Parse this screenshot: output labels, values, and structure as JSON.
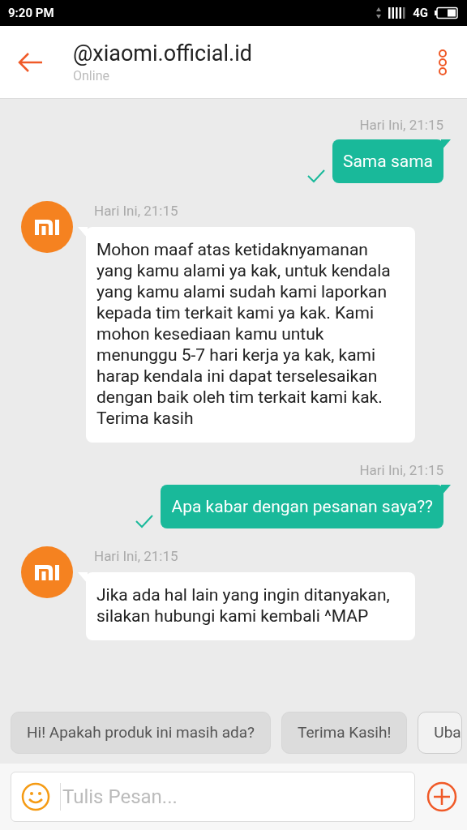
{
  "status_bar": {
    "time": "9:20 PM",
    "network": "4G"
  },
  "header": {
    "title": "@xiaomi.official.id",
    "subtitle": "Online"
  },
  "messages": [
    {
      "kind": "outgoing",
      "time": "Hari Ini, 21:15",
      "text": "Sama sama",
      "read": true
    },
    {
      "kind": "incoming",
      "time": "Hari Ini, 21:15",
      "text": "Mohon maaf atas ketidaknyamanan yang kamu alami ya kak, untuk kendala yang kamu alami sudah kami laporkan kepada tim terkait kami ya kak. Kami mohon kesediaan kamu untuk menunggu 5-7 hari kerja ya kak, kami harap kendala ini dapat terselesaikan dengan baik oleh tim terkait kami kak. Terima kasih"
    },
    {
      "kind": "outgoing",
      "time": "Hari Ini, 21:15",
      "text": "Apa kabar dengan pesanan saya??",
      "read": true
    },
    {
      "kind": "incoming",
      "time": "Hari Ini, 21:15",
      "text": "Jika ada hal lain yang ingin ditanyakan, silakan hubungi kami kembali ^MAP"
    }
  ],
  "quick_replies": [
    {
      "label": "Hi! Apakah produk ini masih ada?",
      "kind": "filled"
    },
    {
      "label": "Terima Kasih!",
      "kind": "filled"
    },
    {
      "label": "Uba",
      "kind": "outlined"
    }
  ],
  "composer": {
    "placeholder": "Tulis Pesan..."
  }
}
